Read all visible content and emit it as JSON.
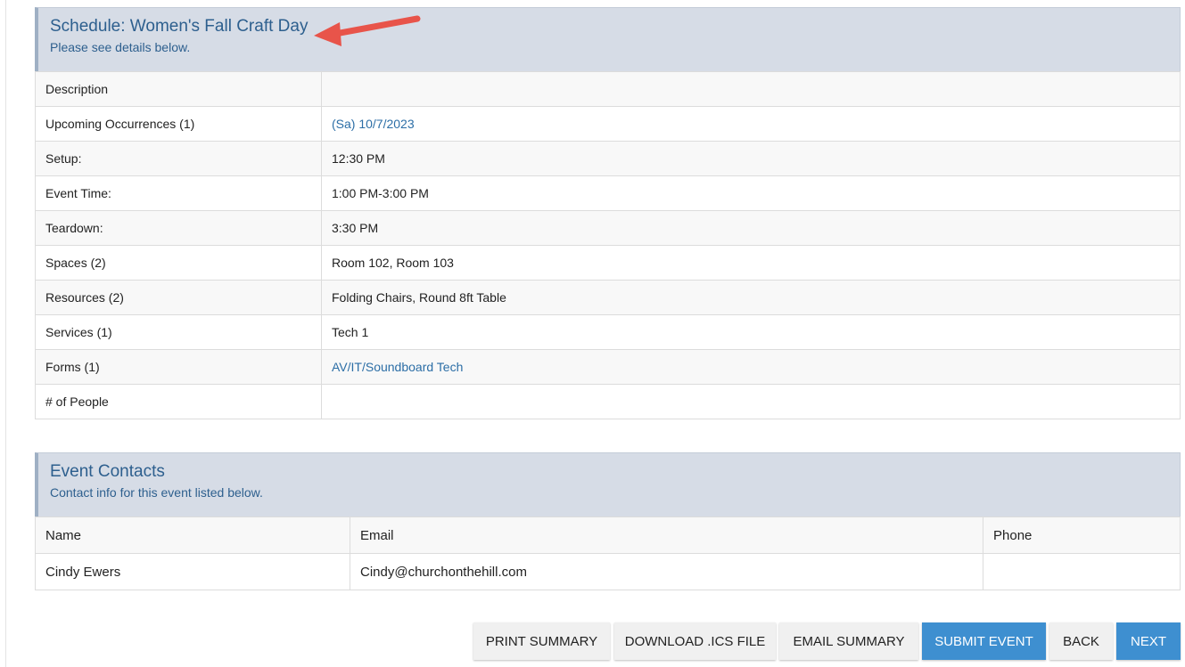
{
  "schedule": {
    "title": "Schedule: Women's Fall Craft Day",
    "subtitle": "Please see details below.",
    "rows": [
      {
        "label": "Description",
        "value": ""
      },
      {
        "label": "Upcoming Occurrences (1)",
        "value": "(Sa) 10/7/2023"
      },
      {
        "label": "Setup:",
        "value": "12:30 PM"
      },
      {
        "label": "Event Time:",
        "value": "1:00 PM-3:00 PM"
      },
      {
        "label": "Teardown:",
        "value": "3:30 PM"
      },
      {
        "label": "Spaces (2)",
        "value": "Room 102, Room 103"
      },
      {
        "label": "Resources (2)",
        "value": "Folding Chairs, Round 8ft Table"
      },
      {
        "label": "Services (1)",
        "value": "Tech 1"
      },
      {
        "label": "Forms (1)",
        "value": "AV/IT/Soundboard Tech"
      },
      {
        "label": "# of People",
        "value": ""
      }
    ]
  },
  "contacts": {
    "title": "Event Contacts",
    "subtitle": "Contact info for this event listed below.",
    "columns": [
      "Name",
      "Email",
      "Phone"
    ],
    "rows": [
      {
        "name": "Cindy Ewers",
        "email": "Cindy@churchonthehill.com",
        "phone": ""
      }
    ]
  },
  "buttons": {
    "print": "PRINT SUMMARY",
    "download": "DOWNLOAD .ICS FILE",
    "email": "EMAIL SUMMARY",
    "submit": "SUBMIT EVENT",
    "back": "BACK",
    "next": "NEXT"
  },
  "colors": {
    "header_bg": "#d6dce6",
    "header_text": "#2d5f8e",
    "link": "#2c6ea6",
    "primary_button": "#3e8fd0",
    "annotation_arrow": "#e8544a"
  },
  "icons": {
    "annotation": "red-arrow-icon"
  }
}
